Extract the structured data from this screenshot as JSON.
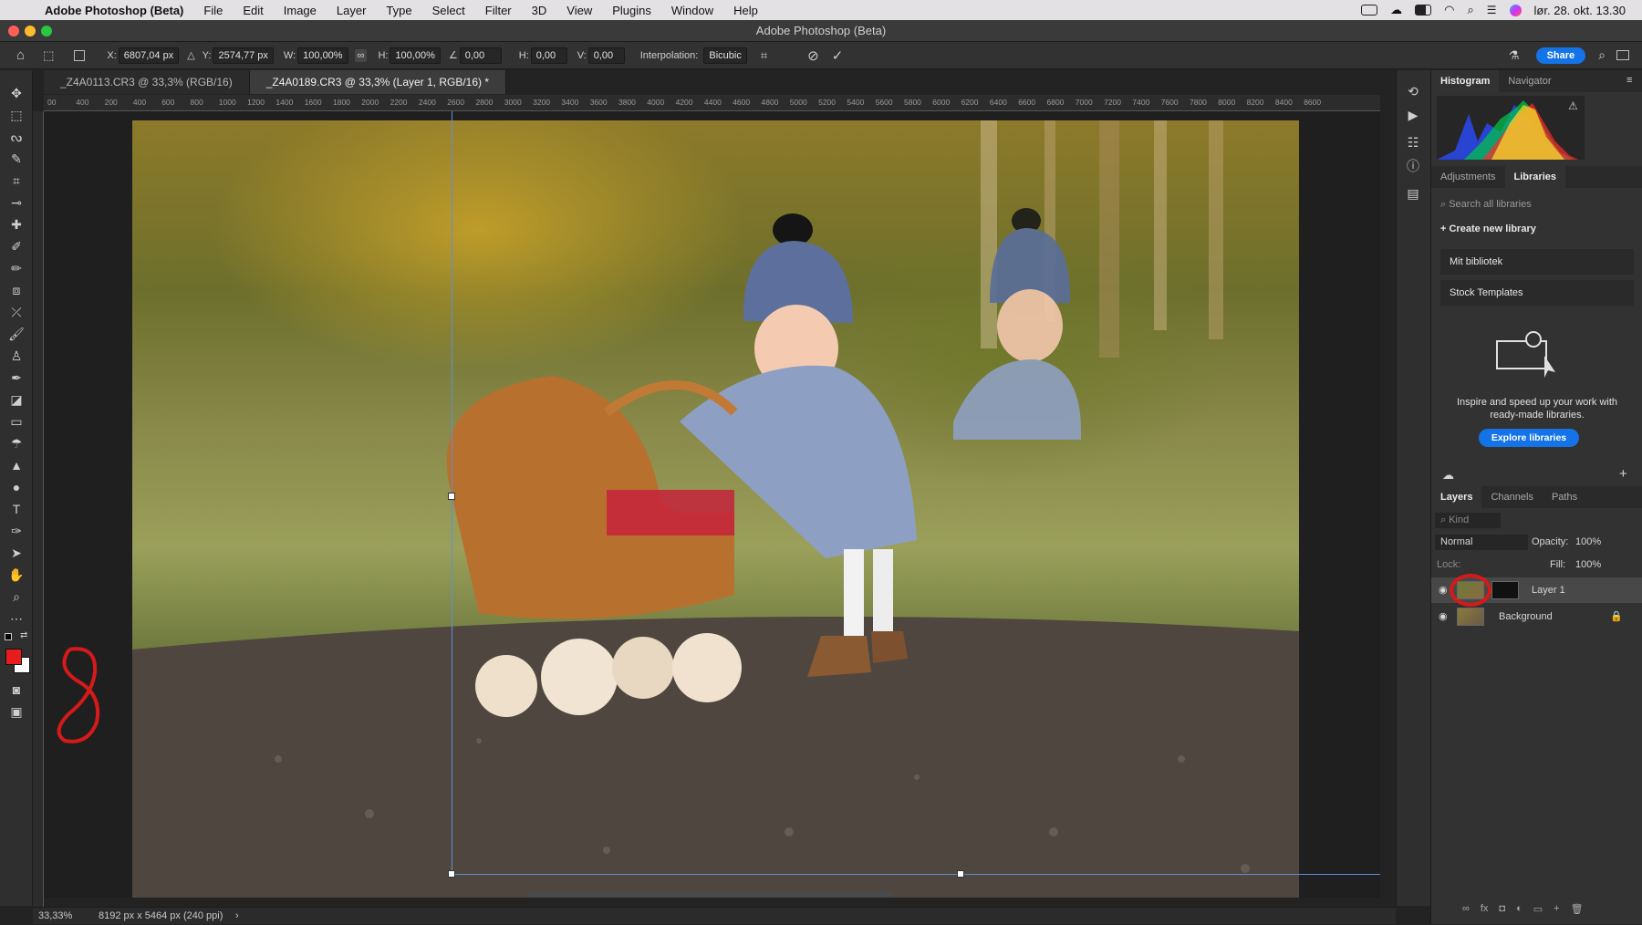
{
  "menubar": {
    "items": [
      "Adobe Photoshop (Beta)",
      "File",
      "Edit",
      "Image",
      "Layer",
      "Type",
      "Select",
      "Filter",
      "3D",
      "View",
      "Plugins",
      "Window",
      "Help"
    ],
    "datetime": "lør. 28. okt. 13.30"
  },
  "window": {
    "title": "Adobe Photoshop (Beta)"
  },
  "options": {
    "x_label": "X:",
    "x_value": "6807,04 px",
    "y_label": "Y:",
    "y_value": "2574,77 px",
    "w_label": "W:",
    "w_value": "100,00%",
    "h_label": "H:",
    "h_value": "100,00%",
    "angle_value": "0,00",
    "hskew_label": "H:",
    "hskew_value": "0,00",
    "vskew_label": "V:",
    "vskew_value": "0,00",
    "interp_label": "Interpolation:",
    "interp_value": "Bicubic",
    "share_label": "Share"
  },
  "tabs": [
    {
      "label": "_Z4A0113.CR3 @ 33,3% (RGB/16)"
    },
    {
      "label": "_Z4A0189.CR3 @ 33,3% (Layer 1, RGB/16) *"
    }
  ],
  "ruler_h": [
    "00",
    "400",
    "200",
    "400",
    "600",
    "800",
    "1000",
    "1200",
    "1400",
    "1600",
    "1800",
    "2000",
    "2200",
    "2400",
    "2600",
    "2800",
    "3000",
    "3200",
    "3400",
    "3600",
    "3800",
    "4000",
    "4200",
    "4400",
    "4600",
    "4800",
    "5000",
    "5200",
    "5400",
    "5600",
    "5800",
    "6000",
    "6200",
    "6400",
    "6600",
    "6800",
    "7000",
    "7200",
    "7400",
    "7600",
    "7800",
    "8000",
    "8200",
    "8400",
    "8600"
  ],
  "panels": {
    "top_tabs": [
      "Histogram",
      "Navigator"
    ],
    "mid_tabs": [
      "Adjustments",
      "Libraries"
    ],
    "search_placeholder": "Search all libraries",
    "create_library": "Create new library",
    "libraries": [
      "Mit bibliotek",
      "Stock Templates"
    ],
    "promo_text": "Inspire and speed up your work with ready-made libraries.",
    "explore_button": "Explore libraries",
    "layer_tabs": [
      "Layers",
      "Channels",
      "Paths"
    ],
    "kind_placeholder": "Kind",
    "blend_mode": "Normal",
    "opacity_label": "Opacity:",
    "opacity_value": "100%",
    "lock_label": "Lock:",
    "fill_label": "Fill:",
    "fill_value": "100%",
    "layers": [
      {
        "name": "Layer 1"
      },
      {
        "name": "Background"
      }
    ]
  },
  "status": {
    "zoom": "33,33%",
    "doc_info": "8192 px x 5464 px (240 ppi)"
  },
  "colors": {
    "foreground": "#e81c1c",
    "background": "#ffffff",
    "accent": "#1473e6",
    "annotation": "#d61a1a"
  }
}
